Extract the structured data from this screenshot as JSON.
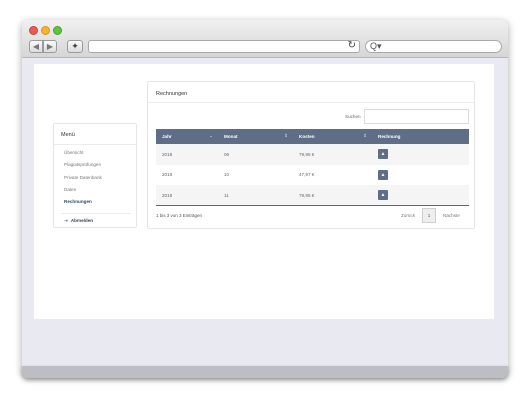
{
  "browser": {
    "back_glyph": "◀",
    "forward_glyph": "▶",
    "bookmark_glyph": "✦",
    "reload_glyph": "↻",
    "search_glyph": "Q▾"
  },
  "sidebar": {
    "title": "Menü",
    "items": [
      {
        "label": "Übersicht"
      },
      {
        "label": "Plagiatsprüfungen"
      },
      {
        "label": "Private Datenbank"
      },
      {
        "label": "Daten"
      },
      {
        "label": "Rechnungen"
      }
    ],
    "active_item": "Rechnungen",
    "logout_label": "Abmelden",
    "logout_icon": "logout-icon"
  },
  "main": {
    "title": "Rechnungen",
    "search_label": "Suchen",
    "table": {
      "headers": [
        "Jahr",
        "Monat",
        "Kosten",
        "Rechnung"
      ],
      "rows": [
        {
          "jahr": "2018",
          "monat": "06",
          "kosten": "79,95 €"
        },
        {
          "jahr": "2018",
          "monat": "10",
          "kosten": "47,97 €"
        },
        {
          "jahr": "2018",
          "monat": "11",
          "kosten": "79,95 €"
        }
      ],
      "download_icon": "download-icon"
    },
    "info": "1 bis 3 von 3 Einträgen",
    "pagination": {
      "prev": "Zurück",
      "current": "1",
      "next": "Nächste"
    }
  },
  "colors": {
    "table_header": "#5e6e86",
    "accent": "#34486a",
    "window_bg": "#e9e9f2"
  }
}
